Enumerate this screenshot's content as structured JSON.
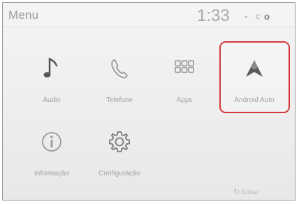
{
  "header": {
    "title": "Menu",
    "time": "1:33",
    "status_icon_a": "c",
    "status_icon_b": "o"
  },
  "tiles": [
    {
      "label": "Áudio",
      "icon": "music-note-icon",
      "interactive": true
    },
    {
      "label": "Telefone",
      "icon": "phone-icon",
      "interactive": true
    },
    {
      "label": "Apps",
      "icon": "apps-grid-icon",
      "interactive": true
    },
    {
      "label": "Android Auto",
      "icon": "android-auto-icon",
      "interactive": true,
      "highlighted": true
    },
    {
      "label": "Informação",
      "icon": "info-icon",
      "interactive": true
    },
    {
      "label": "Configuração",
      "icon": "gear-icon",
      "interactive": true
    }
  ],
  "footer": {
    "edit_label": "Editar"
  },
  "colors": {
    "highlight": "#d23a3a",
    "icon_dark": "#555555",
    "icon_light": "#a9a9a9",
    "text_muted": "#a2a2a2"
  }
}
